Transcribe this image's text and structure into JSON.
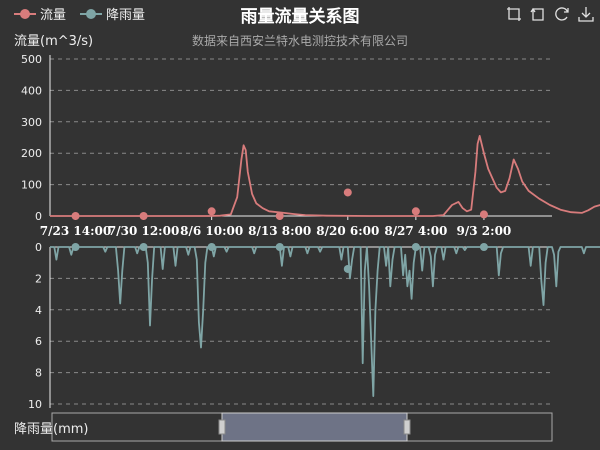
{
  "title": "雨量流量关系图",
  "subtitle": "数据来自西安兰特水电测控技术有限公司",
  "legend": [
    {
      "name": "流量",
      "color": "#d87c7c"
    },
    {
      "name": "降雨量",
      "color": "#7fa5a6"
    }
  ],
  "toolbox": [
    "zoom-icon",
    "zoom-reset-icon",
    "restore-icon",
    "download-icon"
  ],
  "colors": {
    "background": "#333333",
    "flow": "#d87c7c",
    "rain": "#7fa5a6",
    "grid": "#8a8a8a",
    "slider_fill": "#6e7386"
  },
  "chart_data": {
    "type": "line",
    "x_tick_labels": [
      "7/23 14:00",
      "7/30 12:00",
      "8/6 10:00",
      "8/13 8:00",
      "8/20 6:00",
      "8/27 4:00",
      "9/3 2:00"
    ],
    "flow_axis": {
      "label": "流量(m^3/s)",
      "ylim": [
        0,
        500
      ],
      "ticks": [
        0,
        100,
        200,
        300,
        400,
        500
      ]
    },
    "rain_axis": {
      "label": "降雨量(mm)",
      "ylim": [
        0,
        10
      ],
      "inverted": true,
      "ticks": [
        0,
        2,
        4,
        6,
        8,
        10
      ]
    },
    "grid": true,
    "series": [
      {
        "name": "流量",
        "axis": "flow",
        "points": [
          [
            0,
            0
          ],
          [
            20,
            0
          ],
          [
            40,
            0
          ],
          [
            60,
            0
          ],
          [
            75,
            0
          ],
          [
            80,
            1
          ],
          [
            85,
            5
          ],
          [
            88,
            60
          ],
          [
            90,
            180
          ],
          [
            91,
            225
          ],
          [
            92,
            210
          ],
          [
            93,
            140
          ],
          [
            95,
            70
          ],
          [
            97,
            40
          ],
          [
            100,
            25
          ],
          [
            103,
            15
          ],
          [
            110,
            10
          ],
          [
            115,
            6
          ],
          [
            120,
            3
          ],
          [
            125,
            2
          ],
          [
            130,
            1
          ],
          [
            150,
            0
          ],
          [
            180,
            0
          ],
          [
            185,
            3
          ],
          [
            189,
            35
          ],
          [
            192,
            45
          ],
          [
            194,
            25
          ],
          [
            196,
            15
          ],
          [
            198,
            20
          ],
          [
            200,
            140
          ],
          [
            201,
            230
          ],
          [
            202,
            255
          ],
          [
            204,
            200
          ],
          [
            206,
            150
          ],
          [
            208,
            120
          ],
          [
            210,
            90
          ],
          [
            212,
            75
          ],
          [
            214,
            80
          ],
          [
            216,
            120
          ],
          [
            218,
            180
          ],
          [
            220,
            150
          ],
          [
            222,
            110
          ],
          [
            225,
            80
          ],
          [
            230,
            55
          ],
          [
            235,
            35
          ],
          [
            240,
            20
          ],
          [
            245,
            12
          ],
          [
            250,
            10
          ],
          [
            253,
            18
          ],
          [
            256,
            30
          ],
          [
            260,
            38
          ],
          [
            264,
            35
          ],
          [
            268,
            25
          ],
          [
            272,
            20
          ],
          [
            278,
            15
          ],
          [
            285,
            10
          ],
          [
            290,
            8
          ],
          [
            300,
            6
          ],
          [
            310,
            3
          ],
          [
            320,
            1
          ]
        ],
        "markers": [
          [
            12,
            0
          ],
          [
            44,
            0
          ],
          [
            76,
            15
          ],
          [
            108,
            0
          ],
          [
            140,
            75
          ],
          [
            172,
            15
          ],
          [
            204,
            5
          ]
        ]
      },
      {
        "name": "降雨量",
        "axis": "rain",
        "points": [
          [
            0,
            0
          ],
          [
            2,
            0
          ],
          [
            3,
            0.8
          ],
          [
            4,
            0
          ],
          [
            9,
            0
          ],
          [
            10,
            0.5
          ],
          [
            11,
            0
          ],
          [
            25,
            0
          ],
          [
            26,
            0.3
          ],
          [
            27,
            0
          ],
          [
            31,
            0
          ],
          [
            32,
            1.5
          ],
          [
            33,
            3.6
          ],
          [
            34,
            1.5
          ],
          [
            35,
            0
          ],
          [
            40,
            0
          ],
          [
            41,
            0.4
          ],
          [
            42,
            0
          ],
          [
            45,
            0
          ],
          [
            46,
            1
          ],
          [
            47,
            5
          ],
          [
            48,
            2
          ],
          [
            49,
            0
          ],
          [
            52,
            0
          ],
          [
            53,
            1.4
          ],
          [
            54,
            0
          ],
          [
            58,
            0
          ],
          [
            59,
            1.2
          ],
          [
            60,
            0
          ],
          [
            64,
            0
          ],
          [
            65,
            0.5
          ],
          [
            66,
            0
          ],
          [
            68,
            0
          ],
          [
            69,
            0.8
          ],
          [
            70,
            4.8
          ],
          [
            71,
            6.4
          ],
          [
            72,
            4
          ],
          [
            73,
            1
          ],
          [
            74,
            0
          ],
          [
            76,
            0
          ],
          [
            77,
            0.6
          ],
          [
            78,
            0
          ],
          [
            82,
            0
          ],
          [
            83,
            0.3
          ],
          [
            84,
            0
          ],
          [
            95,
            0
          ],
          [
            96,
            0.4
          ],
          [
            97,
            0
          ],
          [
            108,
            0
          ],
          [
            109,
            1.2
          ],
          [
            110,
            0
          ],
          [
            112,
            0
          ],
          [
            113,
            0.6
          ],
          [
            114,
            0
          ],
          [
            120,
            0
          ],
          [
            121,
            0.4
          ],
          [
            122,
            0
          ],
          [
            126,
            0
          ],
          [
            127,
            0.3
          ],
          [
            128,
            0
          ],
          [
            136,
            0
          ],
          [
            137,
            0.8
          ],
          [
            138,
            0
          ],
          [
            140,
            0
          ],
          [
            141,
            2
          ],
          [
            142,
            0.8
          ],
          [
            143,
            0
          ],
          [
            146,
            0
          ],
          [
            147,
            7.4
          ],
          [
            148,
            1.5
          ],
          [
            149,
            0
          ],
          [
            150,
            2.5
          ],
          [
            151,
            6
          ],
          [
            152,
            9.5
          ],
          [
            153,
            4
          ],
          [
            154,
            1.5
          ],
          [
            155,
            0
          ],
          [
            157,
            0
          ],
          [
            158,
            1.2
          ],
          [
            159,
            0
          ],
          [
            160,
            2.5
          ],
          [
            161,
            0.8
          ],
          [
            162,
            0
          ],
          [
            165,
            0
          ],
          [
            166,
            1.8
          ],
          [
            167,
            0.5
          ],
          [
            168,
            2.5
          ],
          [
            169,
            1.5
          ],
          [
            170,
            3.3
          ],
          [
            171,
            1
          ],
          [
            172,
            0
          ],
          [
            174,
            0
          ],
          [
            175,
            1.5
          ],
          [
            176,
            0
          ],
          [
            178,
            0
          ],
          [
            179,
            0.6
          ],
          [
            180,
            2.5
          ],
          [
            181,
            0.5
          ],
          [
            182,
            0
          ],
          [
            184,
            0
          ],
          [
            185,
            0.8
          ],
          [
            186,
            0
          ],
          [
            190,
            0
          ],
          [
            191,
            0.4
          ],
          [
            192,
            0
          ],
          [
            194,
            0
          ],
          [
            195,
            0.2
          ],
          [
            196,
            0
          ],
          [
            210,
            0
          ],
          [
            211,
            1.8
          ],
          [
            212,
            0.4
          ],
          [
            213,
            0
          ],
          [
            225,
            0
          ],
          [
            226,
            1.2
          ],
          [
            227,
            0
          ],
          [
            230,
            0
          ],
          [
            231,
            2.2
          ],
          [
            232,
            3.7
          ],
          [
            233,
            1
          ],
          [
            234,
            0
          ],
          [
            236,
            0
          ],
          [
            237,
            0.5
          ],
          [
            238,
            2.5
          ],
          [
            239,
            0.3
          ],
          [
            240,
            0
          ],
          [
            250,
            0
          ],
          [
            251,
            0.4
          ],
          [
            252,
            0
          ],
          [
            270,
            0
          ],
          [
            271,
            0.2
          ],
          [
            272,
            0
          ],
          [
            290,
            0
          ],
          [
            291,
            0.3
          ],
          [
            292,
            0
          ],
          [
            320,
            0
          ]
        ],
        "markers": [
          [
            12,
            0
          ],
          [
            44,
            0
          ],
          [
            76,
            0
          ],
          [
            108,
            0
          ],
          [
            140,
            1.4
          ],
          [
            172,
            0
          ],
          [
            204,
            0
          ]
        ]
      }
    ],
    "x_tick_positions": [
      12,
      44,
      76,
      108,
      140,
      172,
      204
    ],
    "x_extent": [
      0,
      236
    ],
    "data_zoom": {
      "start": 0.34,
      "end": 0.71
    }
  }
}
